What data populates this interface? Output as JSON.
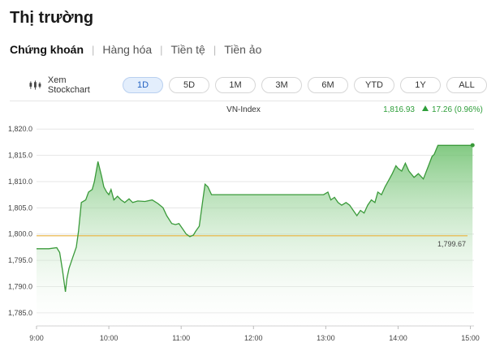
{
  "page": {
    "title": "Thị trường"
  },
  "nav": {
    "tabs": [
      {
        "label": "Chứng khoán",
        "active": true
      },
      {
        "label": "Hàng hóa",
        "active": false
      },
      {
        "label": "Tiền tệ",
        "active": false
      },
      {
        "label": "Tiền ảo",
        "active": false
      }
    ]
  },
  "toolbar": {
    "stockchart_label": "Xem Stockchart",
    "stockchart_icon": "candlestick-icon",
    "ranges": [
      "1D",
      "5D",
      "1M",
      "3M",
      "6M",
      "YTD",
      "1Y",
      "ALL"
    ],
    "active_range": "1D"
  },
  "colors": {
    "line": "#3a9a3a",
    "area_top": "#8ccf8c",
    "reference": "#e9b23c",
    "up": "#2e9e3a",
    "active_tab_bg": "#e3eefc"
  },
  "chart_data": {
    "type": "area",
    "title": "VN-Index",
    "last_value": "1,816.93",
    "change": "17.26 (0.96%)",
    "reference_label": "1,799.67",
    "reference_value": 1799.67,
    "ylim": [
      1782.5,
      1822.5
    ],
    "y_ticks": [
      "1,820.0",
      "1,815.0",
      "1,810.0",
      "1,805.0",
      "1,800.0",
      "1,795.0",
      "1,790.0",
      "1,785.0"
    ],
    "y_tick_values": [
      1820,
      1815,
      1810,
      1805,
      1800,
      1795,
      1790,
      1785
    ],
    "x_ticks": [
      "9:00",
      "10:00",
      "11:00",
      "12:00",
      "13:00",
      "14:00",
      "15:00"
    ],
    "x_tick_values": [
      9,
      10,
      11,
      12,
      13,
      14,
      15
    ],
    "xlim": [
      9,
      15.05
    ],
    "grid": true,
    "series": [
      {
        "x": [
          9.0,
          9.17,
          9.28,
          9.32,
          9.36,
          9.4,
          9.42,
          9.45,
          9.5,
          9.55,
          9.58,
          9.62,
          9.68,
          9.72,
          9.77,
          9.8,
          9.85,
          9.9,
          9.93,
          9.97,
          10.0,
          10.03,
          10.07,
          10.12,
          10.17,
          10.22,
          10.28,
          10.33,
          10.4,
          10.5,
          10.6,
          10.68,
          10.75,
          10.8,
          10.87,
          10.92,
          10.97,
          11.02,
          11.07,
          11.12,
          11.17,
          11.2,
          11.25,
          11.3,
          11.33,
          11.37,
          11.42,
          11.5,
          11.6,
          11.75,
          11.9,
          12.05,
          12.2,
          12.4,
          12.6,
          12.8,
          12.97,
          13.03,
          13.07,
          13.12,
          13.17,
          13.22,
          13.28,
          13.33,
          13.38,
          13.43,
          13.48,
          13.53,
          13.58,
          13.63,
          13.68,
          13.72,
          13.77,
          13.82,
          13.88,
          13.92,
          13.97,
          14.0,
          14.05,
          14.1,
          14.15,
          14.22,
          14.28,
          14.35,
          14.42,
          14.47,
          14.5,
          14.55,
          14.6,
          14.7,
          14.85,
          15.0,
          15.03
        ],
        "y": [
          1797.2,
          1797.2,
          1797.4,
          1796.5,
          1793.0,
          1789.0,
          1791.5,
          1793.5,
          1795.5,
          1797.5,
          1800.5,
          1806.0,
          1806.5,
          1808.0,
          1808.5,
          1810.0,
          1813.8,
          1811.0,
          1809.0,
          1808.0,
          1807.5,
          1808.5,
          1806.5,
          1807.2,
          1806.5,
          1806.0,
          1806.7,
          1806.0,
          1806.3,
          1806.2,
          1806.5,
          1805.8,
          1805.0,
          1803.5,
          1802.0,
          1801.8,
          1802.0,
          1801.0,
          1800.0,
          1799.5,
          1799.8,
          1800.5,
          1801.5,
          1806.5,
          1809.5,
          1809.0,
          1807.5,
          1807.5,
          1807.5,
          1807.5,
          1807.5,
          1807.5,
          1807.5,
          1807.5,
          1807.5,
          1807.5,
          1807.5,
          1808.0,
          1806.5,
          1807.0,
          1806.0,
          1805.5,
          1806.0,
          1805.5,
          1804.5,
          1803.5,
          1804.5,
          1804.0,
          1805.5,
          1806.5,
          1806.0,
          1808.0,
          1807.5,
          1809.0,
          1810.5,
          1811.5,
          1813.0,
          1812.5,
          1812.0,
          1813.5,
          1812.0,
          1810.8,
          1811.5,
          1810.5,
          1813.0,
          1814.8,
          1815.2,
          1816.9,
          1816.9,
          1816.9,
          1816.9,
          1816.9,
          1816.93
        ]
      }
    ]
  }
}
